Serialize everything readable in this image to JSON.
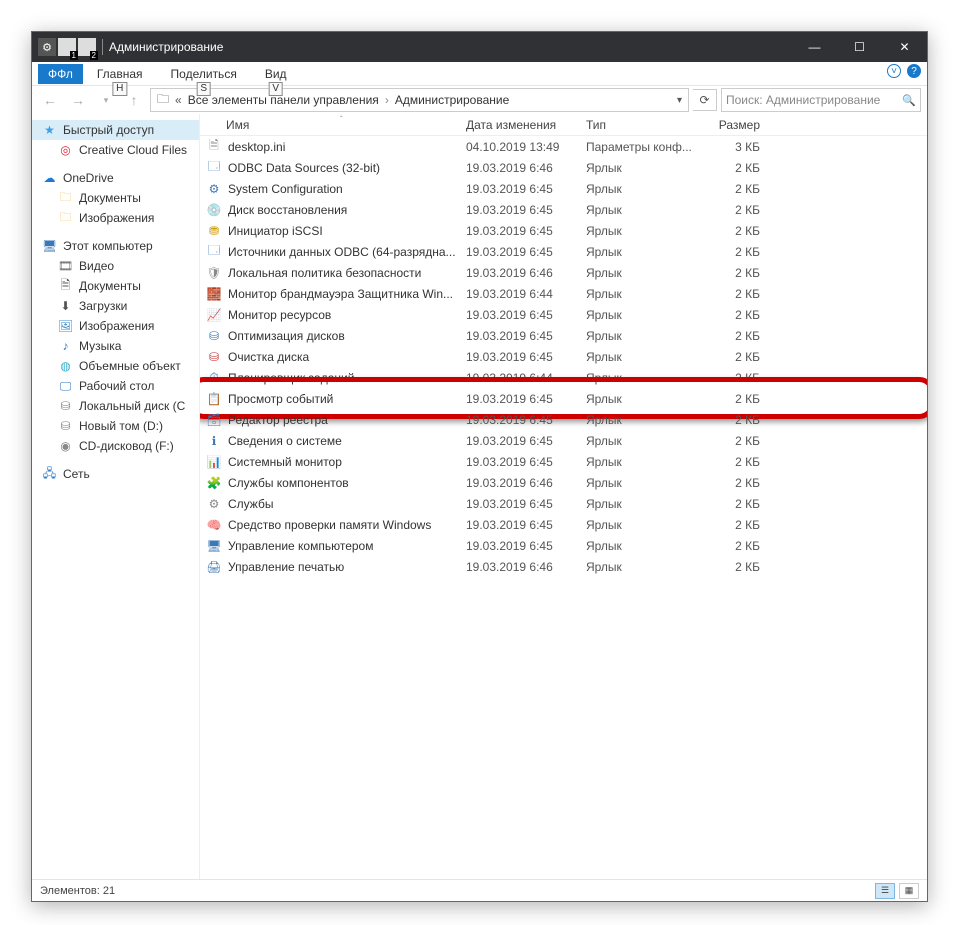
{
  "titlebar": {
    "title": "Администрирование"
  },
  "ribbon": {
    "file": "ФФл",
    "tabs": [
      {
        "label": "Главная",
        "key": "Н"
      },
      {
        "label": "Поделиться",
        "key": "S"
      },
      {
        "label": "Вид",
        "key": "V"
      }
    ]
  },
  "address": {
    "prefix": "«",
    "crumb1": "Все элементы панели управления",
    "crumb2": "Администрирование"
  },
  "search": {
    "placeholder": "Поиск: Администрирование"
  },
  "nav": {
    "items": [
      {
        "label": "Быстрый доступ",
        "cls": "col-star",
        "glyph": "★",
        "sel": true,
        "indent": 0
      },
      {
        "label": "Creative Cloud Files",
        "cls": "col-cc",
        "glyph": "◎",
        "indent": 1
      },
      {
        "spacer": true
      },
      {
        "label": "OneDrive",
        "cls": "col-cloud",
        "glyph": "☁",
        "indent": 0
      },
      {
        "label": "Документы",
        "cls": "col-folder",
        "glyph": "🗀",
        "indent": 1
      },
      {
        "label": "Изображения",
        "cls": "col-folder",
        "glyph": "🗀",
        "indent": 1
      },
      {
        "spacer": true
      },
      {
        "label": "Этот компьютер",
        "cls": "col-pc",
        "glyph": "🖥",
        "indent": 0
      },
      {
        "label": "Видео",
        "cls": "col-vid",
        "glyph": "🎞",
        "indent": 1
      },
      {
        "label": "Документы",
        "cls": "col-doc",
        "glyph": "🗎",
        "indent": 1
      },
      {
        "label": "Загрузки",
        "cls": "col-dl",
        "glyph": "⬇",
        "indent": 1
      },
      {
        "label": "Изображения",
        "cls": "col-img",
        "glyph": "🖼",
        "indent": 1
      },
      {
        "label": "Музыка",
        "cls": "col-mus",
        "glyph": "♪",
        "indent": 1
      },
      {
        "label": "Объемные объект",
        "cls": "col-3d",
        "glyph": "◍",
        "indent": 1
      },
      {
        "label": "Рабочий стол",
        "cls": "col-desk",
        "glyph": "🖵",
        "indent": 1
      },
      {
        "label": "Локальный диск (С",
        "cls": "col-drive",
        "glyph": "⛁",
        "indent": 1
      },
      {
        "label": "Новый том (D:)",
        "cls": "col-drive",
        "glyph": "⛁",
        "indent": 1
      },
      {
        "label": "CD-дисковод (F:)",
        "cls": "col-cd",
        "glyph": "◉",
        "indent": 1
      },
      {
        "spacer": true
      },
      {
        "label": "Сеть",
        "cls": "col-net",
        "glyph": "🖧",
        "indent": 0
      }
    ]
  },
  "columns": {
    "name": "Имя",
    "date": "Дата изменения",
    "type": "Тип",
    "size": "Размер"
  },
  "files": [
    {
      "glyph": "🗎",
      "color": "#888",
      "name": "desktop.ini",
      "date": "04.10.2019 13:49",
      "type": "Параметры конф...",
      "size": "3 КБ"
    },
    {
      "glyph": "🗔",
      "color": "#3b78b5",
      "name": "ODBC Data Sources (32-bit)",
      "date": "19.03.2019 6:46",
      "type": "Ярлык",
      "size": "2 КБ"
    },
    {
      "glyph": "⚙",
      "color": "#3b78b5",
      "name": "System Configuration",
      "date": "19.03.2019 6:45",
      "type": "Ярлык",
      "size": "2 КБ"
    },
    {
      "glyph": "💿",
      "color": "#3b78b5",
      "name": "Диск восстановления",
      "date": "19.03.2019 6:45",
      "type": "Ярлык",
      "size": "2 КБ"
    },
    {
      "glyph": "⛃",
      "color": "#c90",
      "name": "Инициатор iSCSI",
      "date": "19.03.2019 6:45",
      "type": "Ярлык",
      "size": "2 КБ"
    },
    {
      "glyph": "🗔",
      "color": "#3b78b5",
      "name": "Источники данных ODBC (64-разрядна...",
      "date": "19.03.2019 6:45",
      "type": "Ярлык",
      "size": "2 КБ"
    },
    {
      "glyph": "🛡",
      "color": "#888",
      "name": "Локальная политика безопасности",
      "date": "19.03.2019 6:46",
      "type": "Ярлык",
      "size": "2 КБ"
    },
    {
      "glyph": "🧱",
      "color": "#b33",
      "name": "Монитор брандмауэра Защитника Win...",
      "date": "19.03.2019 6:44",
      "type": "Ярлык",
      "size": "2 КБ"
    },
    {
      "glyph": "📈",
      "color": "#2a8",
      "name": "Монитор ресурсов",
      "date": "19.03.2019 6:45",
      "type": "Ярлык",
      "size": "2 КБ"
    },
    {
      "glyph": "⛁",
      "color": "#3b78b5",
      "name": "Оптимизация дисков",
      "date": "19.03.2019 6:45",
      "type": "Ярлык",
      "size": "2 КБ"
    },
    {
      "glyph": "⛁",
      "color": "#c33",
      "name": "Очистка диска",
      "date": "19.03.2019 6:45",
      "type": "Ярлык",
      "size": "2 КБ"
    },
    {
      "glyph": "⏱",
      "color": "#3b78b5",
      "name": "Планировщик заданий",
      "date": "19.03.2019 6:44",
      "type": "Ярлык",
      "size": "2 КБ"
    },
    {
      "glyph": "📋",
      "color": "#3b78b5",
      "name": "Просмотр событий",
      "date": "19.03.2019 6:45",
      "type": "Ярлык",
      "size": "2 КБ",
      "hl": true
    },
    {
      "glyph": "🗃",
      "color": "#3b78b5",
      "name": "Редактор реестра",
      "date": "19.03.2019 6:45",
      "type": "Ярлык",
      "size": "2 КБ"
    },
    {
      "glyph": "ℹ",
      "color": "#3b78b5",
      "name": "Сведения о системе",
      "date": "19.03.2019 6:45",
      "type": "Ярлык",
      "size": "2 КБ"
    },
    {
      "glyph": "📊",
      "color": "#2a8",
      "name": "Системный монитор",
      "date": "19.03.2019 6:45",
      "type": "Ярлык",
      "size": "2 КБ"
    },
    {
      "glyph": "🧩",
      "color": "#3b78b5",
      "name": "Службы компонентов",
      "date": "19.03.2019 6:46",
      "type": "Ярлык",
      "size": "2 КБ"
    },
    {
      "glyph": "⚙",
      "color": "#888",
      "name": "Службы",
      "date": "19.03.2019 6:45",
      "type": "Ярлык",
      "size": "2 КБ"
    },
    {
      "glyph": "🧠",
      "color": "#3b78b5",
      "name": "Средство проверки памяти Windows",
      "date": "19.03.2019 6:45",
      "type": "Ярлык",
      "size": "2 КБ"
    },
    {
      "glyph": "🖥",
      "color": "#3b78b5",
      "name": "Управление компьютером",
      "date": "19.03.2019 6:45",
      "type": "Ярлык",
      "size": "2 КБ"
    },
    {
      "glyph": "🖨",
      "color": "#3b78b5",
      "name": "Управление печатью",
      "date": "19.03.2019 6:46",
      "type": "Ярлык",
      "size": "2 КБ"
    }
  ],
  "status": {
    "count": "Элементов: 21"
  }
}
